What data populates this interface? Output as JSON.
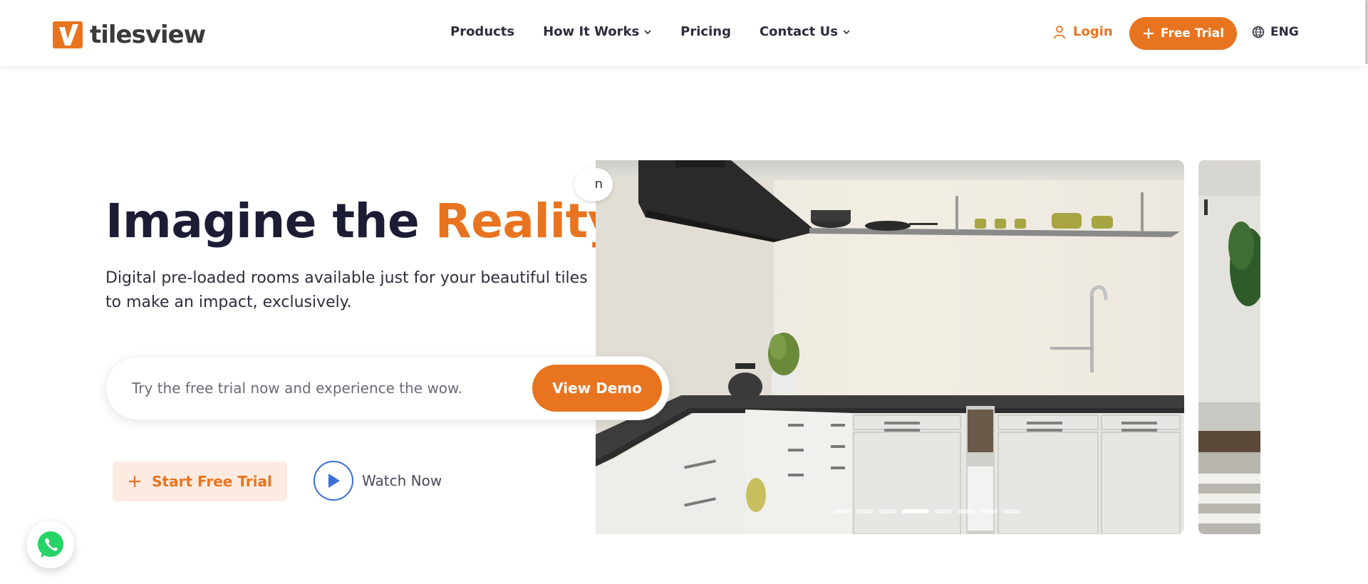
{
  "header": {
    "logo_text": "tilesview",
    "nav": [
      {
        "label": "Products",
        "dropdown": false
      },
      {
        "label": "How It Works",
        "dropdown": true
      },
      {
        "label": "Pricing",
        "dropdown": false
      },
      {
        "label": "Contact Us",
        "dropdown": true
      }
    ],
    "login_label": "Login",
    "free_trial_label": "Free Trial",
    "language_label": "ENG"
  },
  "hero": {
    "title_part1": "Imagine the ",
    "title_accent": "Reality",
    "subtitle": "Digital pre-loaded rooms available just for your beautiful tiles to make an impact, exclusively.",
    "demo_placeholder": "Try the free trial now and experience the wow.",
    "demo_button": "View Demo",
    "start_trial_label": "Start Free Trial",
    "watch_label": "Watch Now"
  },
  "carousel": {
    "badge_fragment": "n",
    "slide_count": 9,
    "active_index": 3
  },
  "colors": {
    "accent": "#e8741f",
    "dark_text": "#1c1c35",
    "trial_bg": "#fdebe1",
    "play_blue": "#3a6fd8",
    "whatsapp_green": "#25d366"
  },
  "icons": [
    "logo-icon",
    "chevron-down-icon",
    "user-icon",
    "plus-icon",
    "globe-icon",
    "play-icon",
    "whatsapp-icon"
  ]
}
